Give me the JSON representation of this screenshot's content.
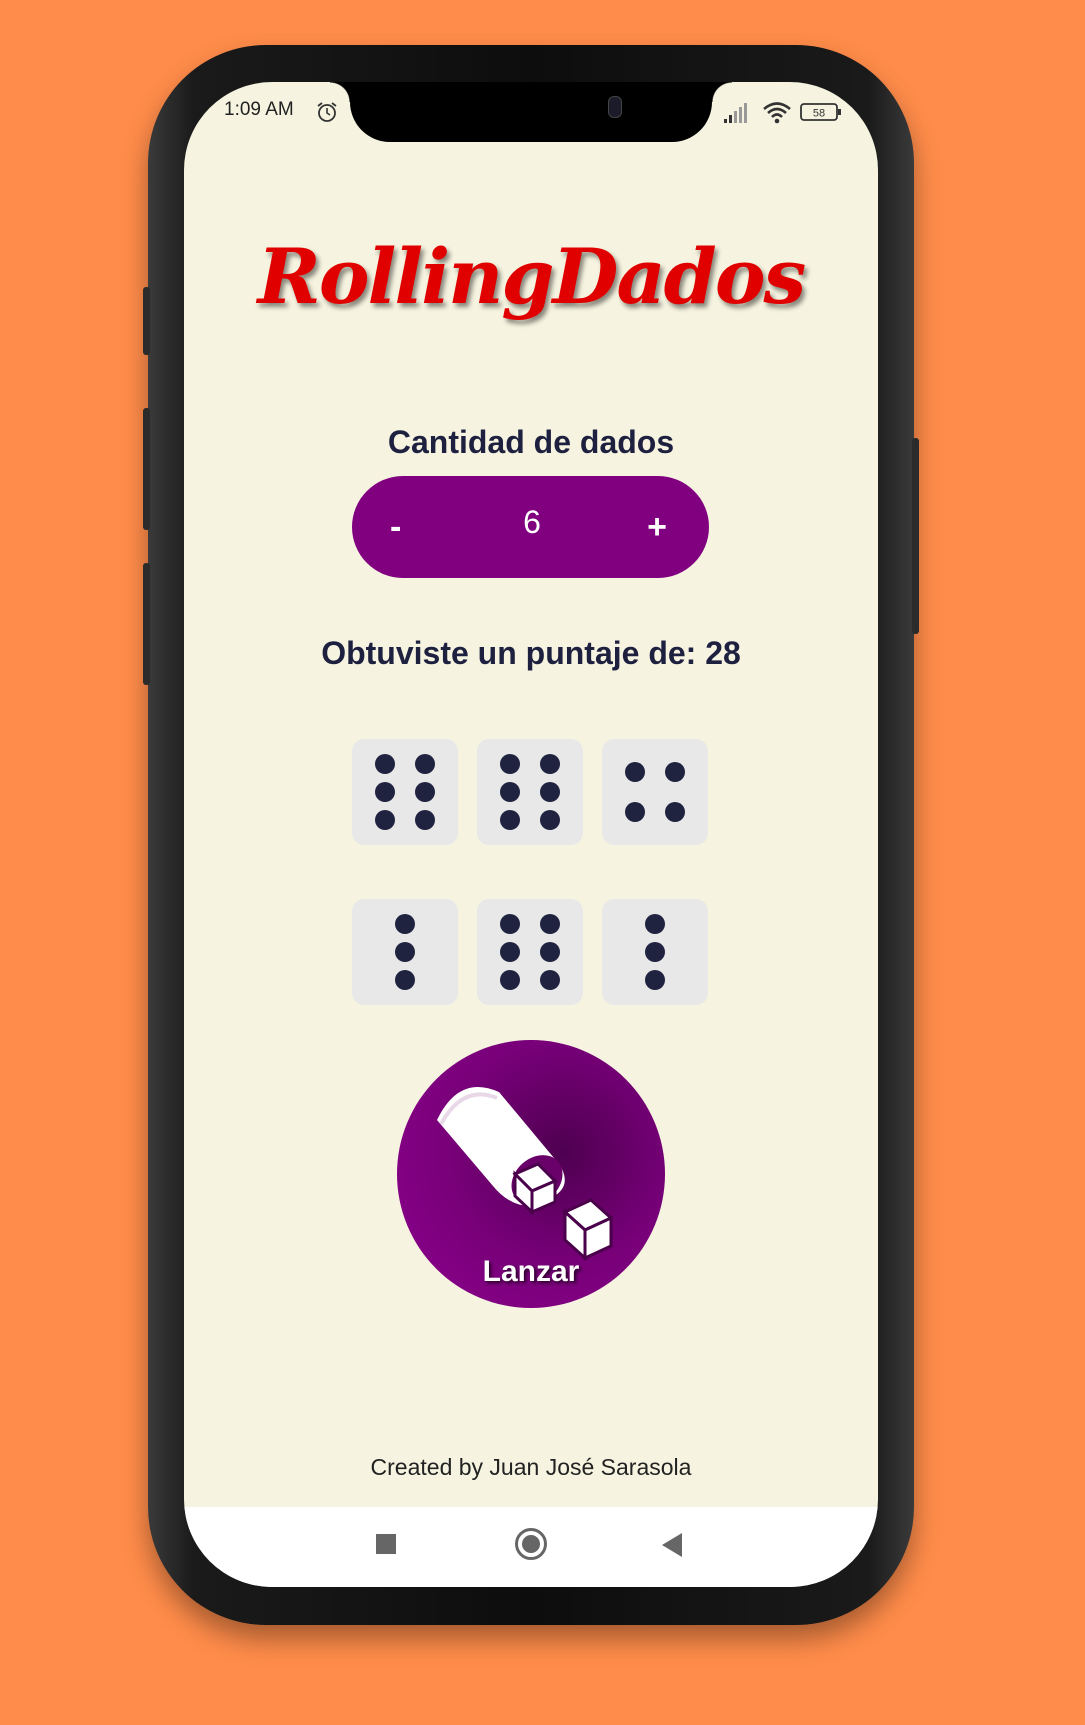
{
  "status_bar": {
    "time": "1:09 AM",
    "alarm_icon": "alarm-clock-icon",
    "signal_icon": "cell-signal-icon",
    "wifi_icon": "wifi-icon",
    "battery_level": "58"
  },
  "app": {
    "logo_text": "RollingDados",
    "quantity_label": "Cantidad de dados",
    "stepper": {
      "minus": "-",
      "value": "6",
      "plus": "+"
    },
    "score_text": "Obtuviste un puntaje de: 28",
    "dice": [
      6,
      6,
      4,
      3,
      6,
      3
    ],
    "roll_button": {
      "label": "Lanzar",
      "icon": "dice-cup-icon"
    },
    "footer": "Created by Juan José Sarasola"
  },
  "nav_bar": {
    "items": [
      "recents-square-icon",
      "home-circle-icon",
      "back-triangle-icon"
    ]
  },
  "colors": {
    "page_background": "#ff8c4a",
    "app_background": "#f6f4e0",
    "accent_purple": "#800080",
    "logo_red": "#e10000",
    "text_dark": "#1e2040",
    "die_face": "#e8e8e8"
  }
}
